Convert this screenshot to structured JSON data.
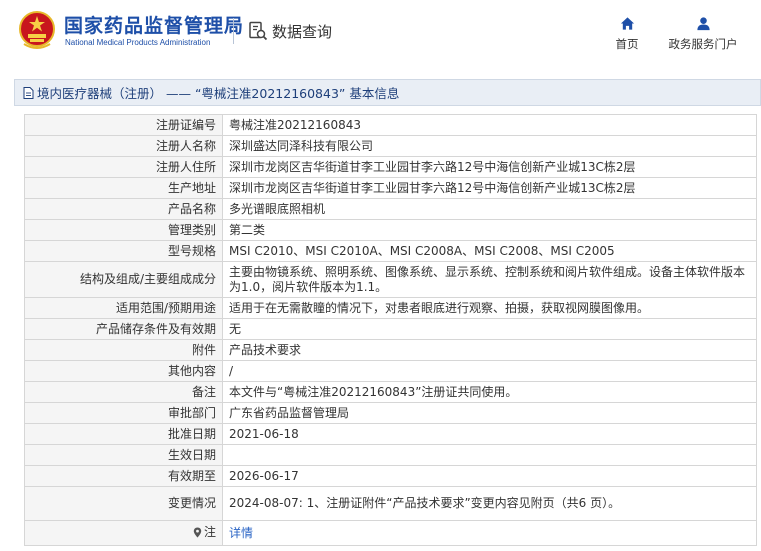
{
  "site": {
    "title": "国家药品监督管理局",
    "subtitle": "National Medical Products Administration",
    "emblem_icon": "national-emblem-icon",
    "brand_color": "#1e4fa8"
  },
  "header": {
    "data_query": {
      "label": "数据查询",
      "icon": "search-document-icon"
    },
    "nav": [
      {
        "label": "首页",
        "icon": "home-icon"
      },
      {
        "label": "政务服务门户",
        "icon": "user-icon"
      }
    ]
  },
  "section": {
    "icon": "document-icon",
    "title": "境内医疗器械（注册） —— “粤械注准20212160843” 基本信息"
  },
  "details": {
    "rows": [
      {
        "label": "注册证编号",
        "value": "粤械注准20212160843"
      },
      {
        "label": "注册人名称",
        "value": "深圳盛达同泽科技有限公司"
      },
      {
        "label": "注册人住所",
        "value": "深圳市龙岗区吉华街道甘李工业园甘李六路12号中海信创新产业城13C栋2层"
      },
      {
        "label": "生产地址",
        "value": "深圳市龙岗区吉华街道甘李工业园甘李六路12号中海信创新产业城13C栋2层"
      },
      {
        "label": "产品名称",
        "value": "多光谱眼底照相机"
      },
      {
        "label": "管理类别",
        "value": "第二类"
      },
      {
        "label": "型号规格",
        "value": "MSI C2010、MSI C2010A、MSI C2008A、MSI C2008、MSI C2005"
      },
      {
        "label": "结构及组成/主要组成成分",
        "value": "主要由物镜系统、照明系统、图像系统、显示系统、控制系统和阅片软件组成。设备主体软件版本为1.0，阅片软件版本为1.1。"
      },
      {
        "label": "适用范围/预期用途",
        "value": "适用于在无需散瞳的情况下，对患者眼底进行观察、拍摄，获取视网膜图像用。"
      },
      {
        "label": "产品储存条件及有效期",
        "value": "无"
      },
      {
        "label": "附件",
        "value": "产品技术要求"
      },
      {
        "label": "其他内容",
        "value": "/"
      },
      {
        "label": "备注",
        "value": "本文件与“粤械注准20212160843”注册证共同使用。"
      },
      {
        "label": "审批部门",
        "value": "广东省药品监督管理局"
      },
      {
        "label": "批准日期",
        "value": "2021-06-18"
      },
      {
        "label": "生效日期",
        "value": ""
      },
      {
        "label": "有效期至",
        "value": "2026-06-17"
      },
      {
        "label": "变更情况",
        "value": "2024-08-07: 1、注册证附件“产品技术要求”变更内容见附页（共6 页）。"
      }
    ],
    "note": {
      "label": "注",
      "icon": "location-pin-icon",
      "link": "详情"
    }
  }
}
